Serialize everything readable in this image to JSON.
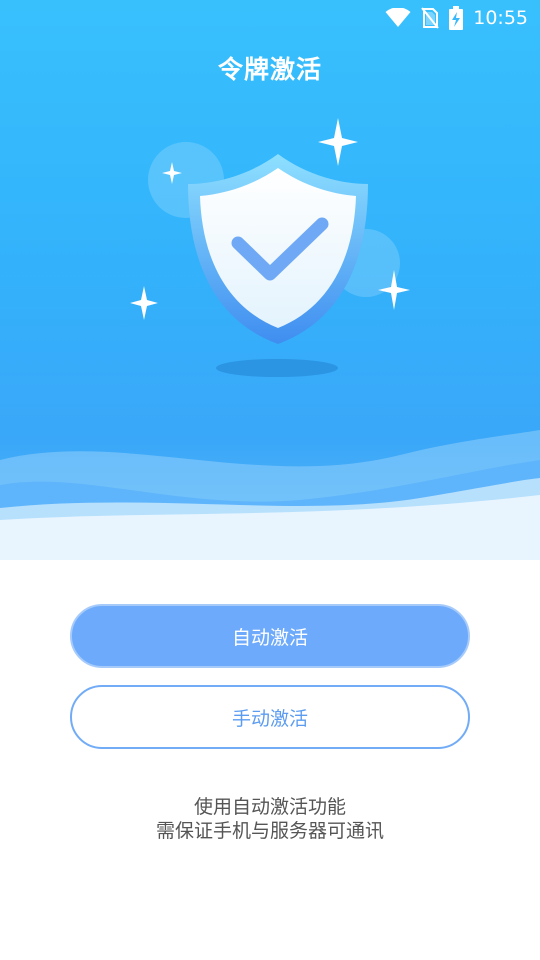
{
  "status_bar": {
    "time": "10:55",
    "icons": [
      "wifi-icon",
      "no-sim-icon",
      "battery-charging-icon"
    ]
  },
  "header": {
    "title": "令牌激活"
  },
  "illustration": {
    "icon": "shield-check-icon",
    "decorations": [
      "sparkle-icon",
      "sparkle-icon",
      "sparkle-icon",
      "sparkle-icon"
    ]
  },
  "actions": {
    "auto_label": "自动激活",
    "manual_label": "手动激活"
  },
  "hint": {
    "line1": "使用自动激活功能",
    "line2": "需保证手机与服务器可通讯"
  },
  "colors": {
    "hero_top": "#38c0fd",
    "hero_bottom": "#3aa7f8",
    "primary_button": "#6daafb",
    "secondary_border": "#72acf6",
    "secondary_text": "#5c9cf0"
  }
}
